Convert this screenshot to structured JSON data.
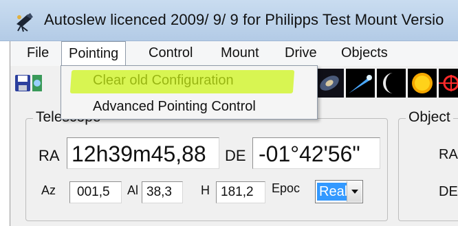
{
  "window": {
    "title": "Autoslew licenced  2009/ 9/ 9 for Philipps Test Mount Versio",
    "icon": "telescope-app-icon"
  },
  "menubar": {
    "items": [
      {
        "label": "File"
      },
      {
        "label": "Pointing"
      },
      {
        "label": "Control"
      },
      {
        "label": "Mount"
      },
      {
        "label": "Drive"
      },
      {
        "label": "Objects"
      }
    ]
  },
  "toolbar": {
    "buttons": [
      {
        "icon": "save-icon"
      },
      {
        "icon": "open-icon"
      },
      {
        "icon": "galaxy-icon"
      },
      {
        "icon": "comet-icon"
      },
      {
        "icon": "moon-icon"
      },
      {
        "icon": "sun-icon"
      },
      {
        "icon": "target-icon"
      }
    ]
  },
  "pointing_menu": {
    "items": [
      {
        "label": "Clear old Configuration",
        "highlighted": true
      },
      {
        "label": "Advanced Pointing Control"
      }
    ],
    "highlight_color": "#cdf514"
  },
  "telescope": {
    "title": "Telescope",
    "ra_label": "RA",
    "ra_value": "12h39m45,88",
    "de_label": "DE",
    "de_value": "-01°42'56\"",
    "az_label": "Az",
    "az_value": "001,5",
    "alt_label": "Al",
    "alt_value": "38,3",
    "h_label": "H",
    "h_value": "181,2",
    "epoch_label": "Epoc",
    "epoch_value": "Real"
  },
  "object": {
    "title": "Object",
    "ra_label": "RA",
    "de_label": "DE"
  },
  "colors": {
    "titlebar": "#bcd2ea",
    "selection": "#3399ff",
    "window_bg": "#f0f0f0"
  }
}
